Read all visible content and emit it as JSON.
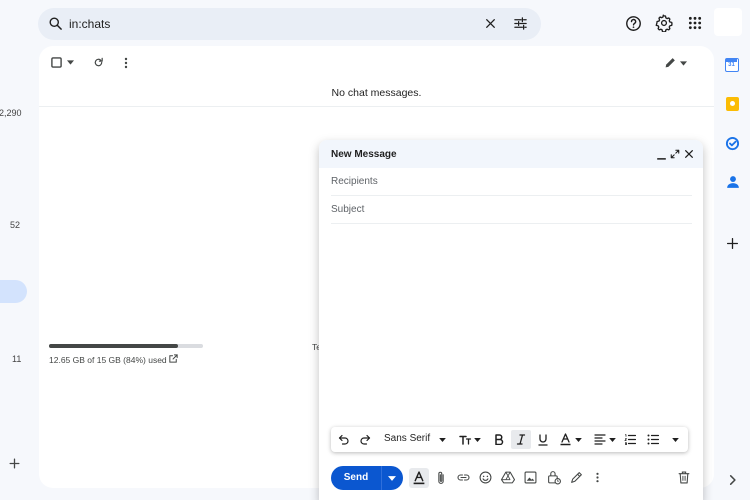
{
  "search": {
    "query": "in:chats"
  },
  "left_rail": {
    "count_top": "2,290",
    "count_mid": "52",
    "count_low": "11"
  },
  "main": {
    "empty_message": "No chat messages.",
    "storage_text": "12.65 GB of 15 GB (84%) used",
    "storage_fraction": 0.84,
    "fragment_text": "Te"
  },
  "compose": {
    "title": "New Message",
    "recipients_placeholder": "Recipients",
    "subject_placeholder": "Subject",
    "font_name": "Sans Serif",
    "send_label": "Send"
  },
  "calendar": {
    "day": "31"
  },
  "colors": {
    "accent": "#0b57d0",
    "search_bg": "#e9eef6",
    "page_bg": "#f6f8fc"
  }
}
